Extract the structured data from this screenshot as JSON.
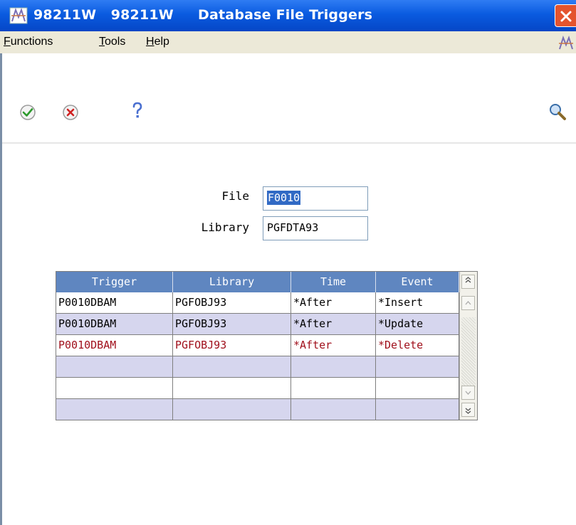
{
  "window": {
    "title": "98211W   98211W     Database File Triggers"
  },
  "menu": {
    "functions": "Functions",
    "tools": "Tools",
    "help": "Help"
  },
  "toolbar": {
    "ok": "ok-check-icon",
    "cancel": "cancel-x-icon",
    "help": "help-question-icon",
    "search": "search-magnifier-icon"
  },
  "form": {
    "file_label": "File",
    "file_value": "F0010",
    "library_label": "Library",
    "library_value": "PGFDTA93"
  },
  "grid": {
    "headers": [
      "Trigger",
      "Library",
      "Time",
      "Event"
    ],
    "rows": [
      [
        "P0010DBAM",
        "PGFOBJ93",
        "*After",
        "*Insert"
      ],
      [
        "P0010DBAM",
        "PGFOBJ93",
        "*After",
        "*Update"
      ],
      [
        "P0010DBAM",
        "PGFOBJ93",
        "*After",
        "*Delete"
      ],
      [
        "",
        "",
        "",
        ""
      ],
      [
        "",
        "",
        "",
        ""
      ],
      [
        "",
        "",
        "",
        ""
      ]
    ]
  },
  "colors": {
    "title_bar": "#0a5be0",
    "grid_header": "#5f86c0",
    "row_alt": "#d6d6ee",
    "selected_row_text": "#a0101c"
  }
}
